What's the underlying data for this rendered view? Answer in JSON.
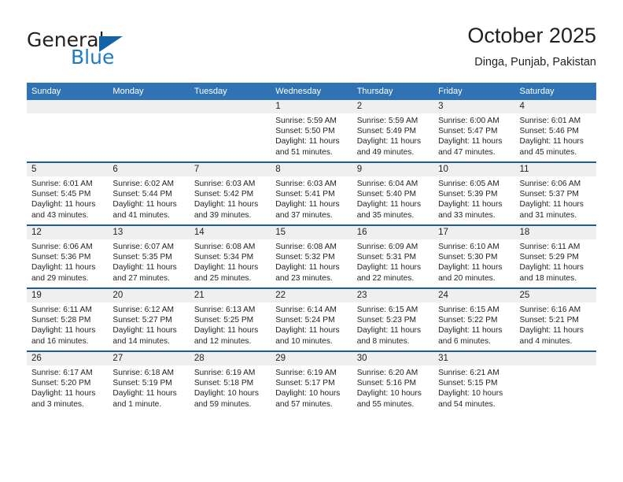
{
  "brand": {
    "name_part1": "General",
    "name_part2": "Blue",
    "triangle_icon": "triangle-icon",
    "color_dark": "#231f20",
    "color_blue": "#1f7ac4"
  },
  "header": {
    "title": "October 2025",
    "subtitle": "Dinga, Punjab, Pakistan"
  },
  "theme": {
    "header_blue": "#3073b4",
    "separator_blue": "#1f5c9e",
    "daynum_band": "#efefef"
  },
  "weekdays": [
    "Sunday",
    "Monday",
    "Tuesday",
    "Wednesday",
    "Thursday",
    "Friday",
    "Saturday"
  ],
  "labels": {
    "sunrise_prefix": "Sunrise:",
    "sunset_prefix": "Sunset:",
    "daylight_prefix": "Daylight:"
  },
  "weeks": [
    [
      {
        "day": "",
        "blank": true,
        "sunrise": "",
        "sunset": "",
        "daylight_line1": "",
        "daylight_line2": ""
      },
      {
        "day": "",
        "blank": true,
        "sunrise": "",
        "sunset": "",
        "daylight_line1": "",
        "daylight_line2": ""
      },
      {
        "day": "",
        "blank": true,
        "sunrise": "",
        "sunset": "",
        "daylight_line1": "",
        "daylight_line2": ""
      },
      {
        "day": "1",
        "blank": false,
        "sunrise": "Sunrise: 5:59 AM",
        "sunset": "Sunset: 5:50 PM",
        "daylight_line1": "Daylight: 11 hours",
        "daylight_line2": "and 51 minutes."
      },
      {
        "day": "2",
        "blank": false,
        "sunrise": "Sunrise: 5:59 AM",
        "sunset": "Sunset: 5:49 PM",
        "daylight_line1": "Daylight: 11 hours",
        "daylight_line2": "and 49 minutes."
      },
      {
        "day": "3",
        "blank": false,
        "sunrise": "Sunrise: 6:00 AM",
        "sunset": "Sunset: 5:47 PM",
        "daylight_line1": "Daylight: 11 hours",
        "daylight_line2": "and 47 minutes."
      },
      {
        "day": "4",
        "blank": false,
        "sunrise": "Sunrise: 6:01 AM",
        "sunset": "Sunset: 5:46 PM",
        "daylight_line1": "Daylight: 11 hours",
        "daylight_line2": "and 45 minutes."
      }
    ],
    [
      {
        "day": "5",
        "blank": false,
        "sunrise": "Sunrise: 6:01 AM",
        "sunset": "Sunset: 5:45 PM",
        "daylight_line1": "Daylight: 11 hours",
        "daylight_line2": "and 43 minutes."
      },
      {
        "day": "6",
        "blank": false,
        "sunrise": "Sunrise: 6:02 AM",
        "sunset": "Sunset: 5:44 PM",
        "daylight_line1": "Daylight: 11 hours",
        "daylight_line2": "and 41 minutes."
      },
      {
        "day": "7",
        "blank": false,
        "sunrise": "Sunrise: 6:03 AM",
        "sunset": "Sunset: 5:42 PM",
        "daylight_line1": "Daylight: 11 hours",
        "daylight_line2": "and 39 minutes."
      },
      {
        "day": "8",
        "blank": false,
        "sunrise": "Sunrise: 6:03 AM",
        "sunset": "Sunset: 5:41 PM",
        "daylight_line1": "Daylight: 11 hours",
        "daylight_line2": "and 37 minutes."
      },
      {
        "day": "9",
        "blank": false,
        "sunrise": "Sunrise: 6:04 AM",
        "sunset": "Sunset: 5:40 PM",
        "daylight_line1": "Daylight: 11 hours",
        "daylight_line2": "and 35 minutes."
      },
      {
        "day": "10",
        "blank": false,
        "sunrise": "Sunrise: 6:05 AM",
        "sunset": "Sunset: 5:39 PM",
        "daylight_line1": "Daylight: 11 hours",
        "daylight_line2": "and 33 minutes."
      },
      {
        "day": "11",
        "blank": false,
        "sunrise": "Sunrise: 6:06 AM",
        "sunset": "Sunset: 5:37 PM",
        "daylight_line1": "Daylight: 11 hours",
        "daylight_line2": "and 31 minutes."
      }
    ],
    [
      {
        "day": "12",
        "blank": false,
        "sunrise": "Sunrise: 6:06 AM",
        "sunset": "Sunset: 5:36 PM",
        "daylight_line1": "Daylight: 11 hours",
        "daylight_line2": "and 29 minutes."
      },
      {
        "day": "13",
        "blank": false,
        "sunrise": "Sunrise: 6:07 AM",
        "sunset": "Sunset: 5:35 PM",
        "daylight_line1": "Daylight: 11 hours",
        "daylight_line2": "and 27 minutes."
      },
      {
        "day": "14",
        "blank": false,
        "sunrise": "Sunrise: 6:08 AM",
        "sunset": "Sunset: 5:34 PM",
        "daylight_line1": "Daylight: 11 hours",
        "daylight_line2": "and 25 minutes."
      },
      {
        "day": "15",
        "blank": false,
        "sunrise": "Sunrise: 6:08 AM",
        "sunset": "Sunset: 5:32 PM",
        "daylight_line1": "Daylight: 11 hours",
        "daylight_line2": "and 23 minutes."
      },
      {
        "day": "16",
        "blank": false,
        "sunrise": "Sunrise: 6:09 AM",
        "sunset": "Sunset: 5:31 PM",
        "daylight_line1": "Daylight: 11 hours",
        "daylight_line2": "and 22 minutes."
      },
      {
        "day": "17",
        "blank": false,
        "sunrise": "Sunrise: 6:10 AM",
        "sunset": "Sunset: 5:30 PM",
        "daylight_line1": "Daylight: 11 hours",
        "daylight_line2": "and 20 minutes."
      },
      {
        "day": "18",
        "blank": false,
        "sunrise": "Sunrise: 6:11 AM",
        "sunset": "Sunset: 5:29 PM",
        "daylight_line1": "Daylight: 11 hours",
        "daylight_line2": "and 18 minutes."
      }
    ],
    [
      {
        "day": "19",
        "blank": false,
        "sunrise": "Sunrise: 6:11 AM",
        "sunset": "Sunset: 5:28 PM",
        "daylight_line1": "Daylight: 11 hours",
        "daylight_line2": "and 16 minutes."
      },
      {
        "day": "20",
        "blank": false,
        "sunrise": "Sunrise: 6:12 AM",
        "sunset": "Sunset: 5:27 PM",
        "daylight_line1": "Daylight: 11 hours",
        "daylight_line2": "and 14 minutes."
      },
      {
        "day": "21",
        "blank": false,
        "sunrise": "Sunrise: 6:13 AM",
        "sunset": "Sunset: 5:25 PM",
        "daylight_line1": "Daylight: 11 hours",
        "daylight_line2": "and 12 minutes."
      },
      {
        "day": "22",
        "blank": false,
        "sunrise": "Sunrise: 6:14 AM",
        "sunset": "Sunset: 5:24 PM",
        "daylight_line1": "Daylight: 11 hours",
        "daylight_line2": "and 10 minutes."
      },
      {
        "day": "23",
        "blank": false,
        "sunrise": "Sunrise: 6:15 AM",
        "sunset": "Sunset: 5:23 PM",
        "daylight_line1": "Daylight: 11 hours",
        "daylight_line2": "and 8 minutes."
      },
      {
        "day": "24",
        "blank": false,
        "sunrise": "Sunrise: 6:15 AM",
        "sunset": "Sunset: 5:22 PM",
        "daylight_line1": "Daylight: 11 hours",
        "daylight_line2": "and 6 minutes."
      },
      {
        "day": "25",
        "blank": false,
        "sunrise": "Sunrise: 6:16 AM",
        "sunset": "Sunset: 5:21 PM",
        "daylight_line1": "Daylight: 11 hours",
        "daylight_line2": "and 4 minutes."
      }
    ],
    [
      {
        "day": "26",
        "blank": false,
        "sunrise": "Sunrise: 6:17 AM",
        "sunset": "Sunset: 5:20 PM",
        "daylight_line1": "Daylight: 11 hours",
        "daylight_line2": "and 3 minutes."
      },
      {
        "day": "27",
        "blank": false,
        "sunrise": "Sunrise: 6:18 AM",
        "sunset": "Sunset: 5:19 PM",
        "daylight_line1": "Daylight: 11 hours",
        "daylight_line2": "and 1 minute."
      },
      {
        "day": "28",
        "blank": false,
        "sunrise": "Sunrise: 6:19 AM",
        "sunset": "Sunset: 5:18 PM",
        "daylight_line1": "Daylight: 10 hours",
        "daylight_line2": "and 59 minutes."
      },
      {
        "day": "29",
        "blank": false,
        "sunrise": "Sunrise: 6:19 AM",
        "sunset": "Sunset: 5:17 PM",
        "daylight_line1": "Daylight: 10 hours",
        "daylight_line2": "and 57 minutes."
      },
      {
        "day": "30",
        "blank": false,
        "sunrise": "Sunrise: 6:20 AM",
        "sunset": "Sunset: 5:16 PM",
        "daylight_line1": "Daylight: 10 hours",
        "daylight_line2": "and 55 minutes."
      },
      {
        "day": "31",
        "blank": false,
        "sunrise": "Sunrise: 6:21 AM",
        "sunset": "Sunset: 5:15 PM",
        "daylight_line1": "Daylight: 10 hours",
        "daylight_line2": "and 54 minutes."
      },
      {
        "day": "",
        "blank": true,
        "sunrise": "",
        "sunset": "",
        "daylight_line1": "",
        "daylight_line2": ""
      }
    ]
  ]
}
